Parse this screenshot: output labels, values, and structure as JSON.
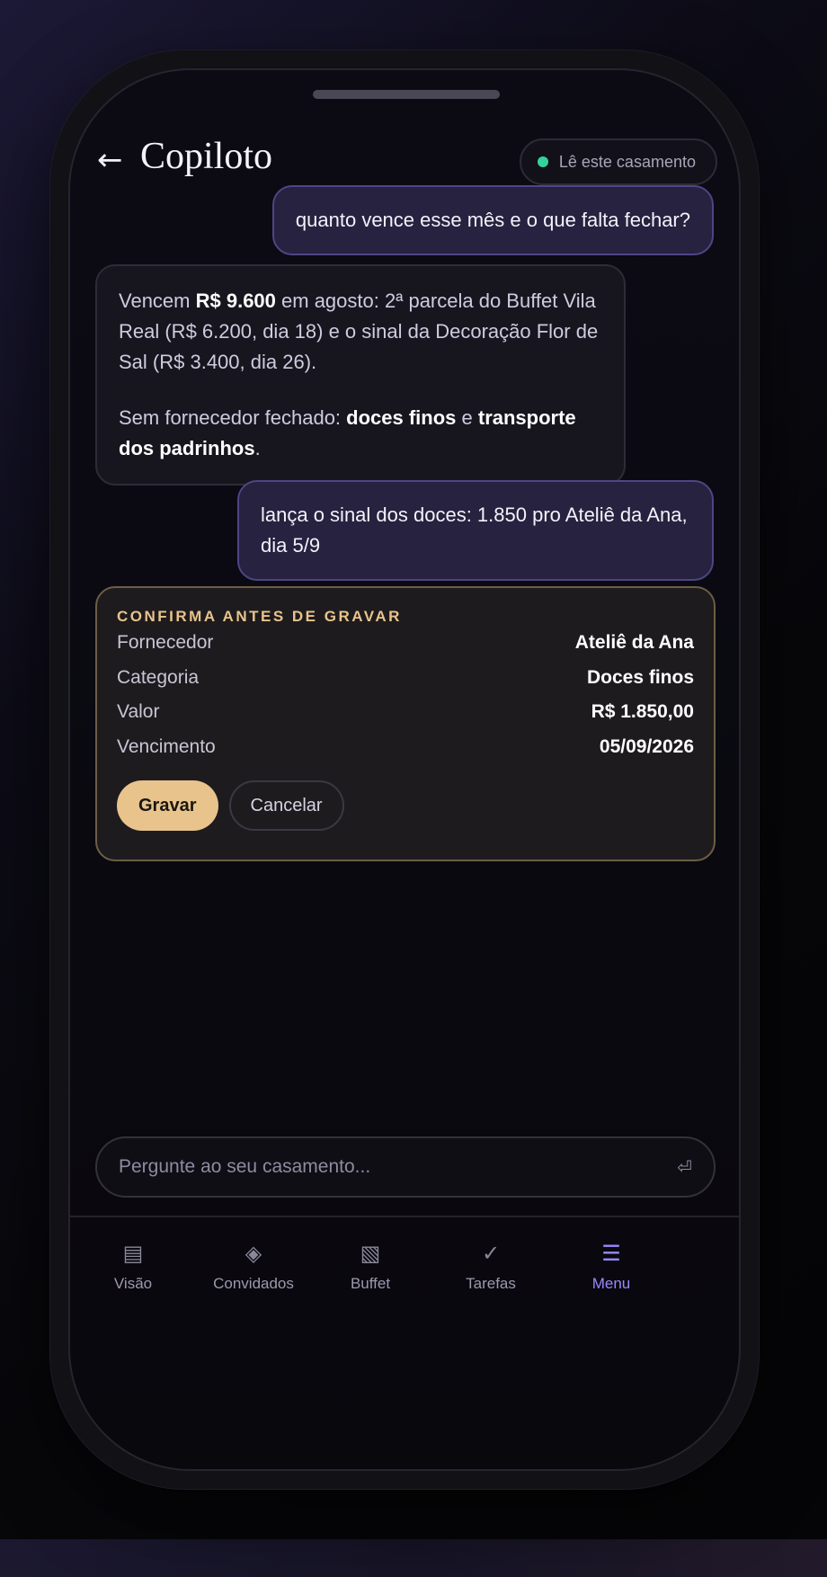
{
  "header": {
    "back_icon": "←",
    "title": "Copiloto",
    "context_label": "Lê este casamento",
    "context_status_color": "#34d399"
  },
  "messages": {
    "user_1": "quanto vence esse mês e o que falta fechar?",
    "bot_1": {
      "p1_a": "Vencem ",
      "p1_amount": "R$ 9.600",
      "p1_b": " em agosto: 2ª parcela do Buffet Vila Real (R$ 6.200, dia 18) e o sinal da Decoração Flor de Sal (R$ 3.400, dia 26).",
      "p2_a": "Sem fornecedor fechado: ",
      "p2_item1": "doces finos",
      "p2_mid": " e ",
      "p2_item2": "transporte dos padrinhos",
      "p2_end": "."
    },
    "user_2": "lança o sinal dos doces: 1.850 pro Ateliê da Ana, dia 5/9"
  },
  "confirm": {
    "title": "CONFIRMA ANTES DE GRAVAR",
    "rows": [
      {
        "label": "Fornecedor",
        "value": "Ateliê da Ana"
      },
      {
        "label": "Categoria",
        "value": "Doces finos"
      },
      {
        "label": "Valor",
        "value": "R$ 1.850,00"
      },
      {
        "label": "Vencimento",
        "value": "05/09/2026"
      }
    ],
    "save_label": "Gravar",
    "cancel_label": "Cancelar",
    "accent_color": "#e8c48c"
  },
  "composer": {
    "placeholder": "Pergunte ao seu casamento...",
    "send_icon": "⏎"
  },
  "tabs": [
    {
      "label": "Visão",
      "icon": "▤",
      "icon_name": "overview-icon"
    },
    {
      "label": "Convidados",
      "icon": "◈",
      "icon_name": "guests-icon"
    },
    {
      "label": "Buffet",
      "icon": "▧",
      "icon_name": "buffet-icon"
    },
    {
      "label": "Tarefas",
      "icon": "✓",
      "icon_name": "tasks-icon"
    },
    {
      "label": "Menu",
      "icon": "☰",
      "icon_name": "menu-icon",
      "active": true
    }
  ],
  "active_tab_color": "#9a88ff"
}
